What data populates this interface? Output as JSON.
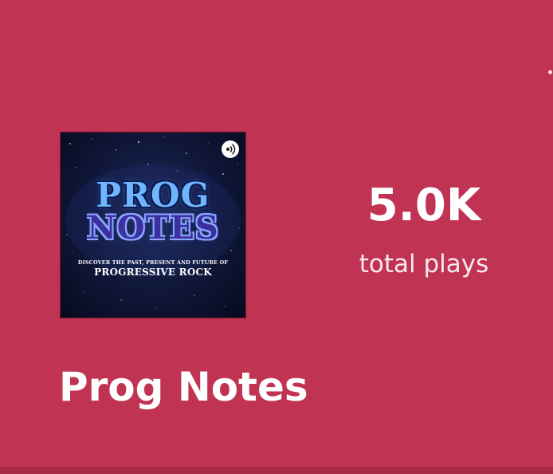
{
  "podcast": {
    "title": "Prog Notes",
    "cover_art": {
      "title_line_1": "PROG",
      "title_line_2": "NOTES",
      "tagline": "DISCOVER THE PAST, PRESENT AND FUTURE OF",
      "subtitle": "PROGRESSIVE ROCK",
      "badge_icon": "podcast-broadcast-icon"
    }
  },
  "stats": {
    "plays_value": "5.0K",
    "plays_label": "total plays"
  },
  "colors": {
    "background": "#c03353",
    "text": "#ffffff",
    "cover_background": "#0f1638",
    "cover_title_top": "#6fb6ff",
    "cover_title_bottom": "#3c2f9e"
  }
}
